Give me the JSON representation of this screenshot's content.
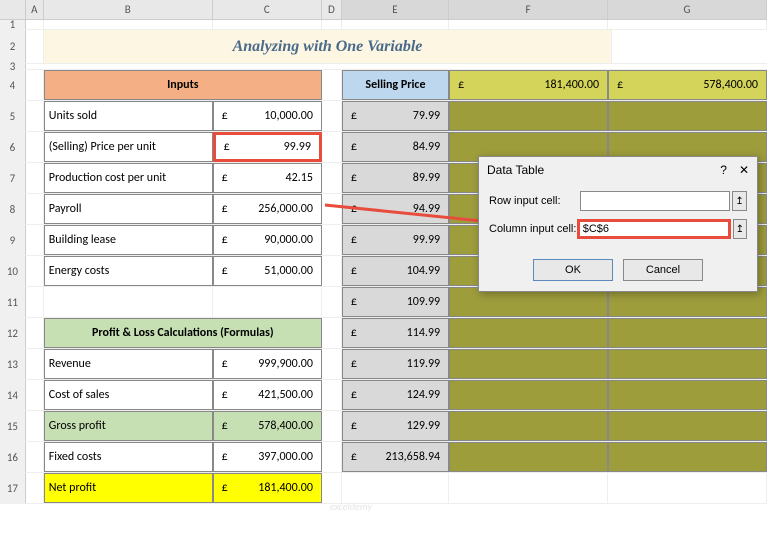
{
  "title": "Analyzing with One Variable",
  "cols": [
    "A",
    "B",
    "C",
    "D",
    "E",
    "F",
    "G"
  ],
  "rows": [
    "1",
    "2",
    "3",
    "4",
    "5",
    "6",
    "7",
    "8",
    "9",
    "10",
    "11",
    "12",
    "13",
    "14",
    "15",
    "16",
    "17"
  ],
  "inputs_header": "Inputs",
  "inputs": [
    {
      "label": "Units sold",
      "curr": "£",
      "val": "10,000.00"
    },
    {
      "label": "(Selling) Price per unit",
      "curr": "£",
      "val": "99.99"
    },
    {
      "label": "Production cost per unit",
      "curr": "£",
      "val": "42.15"
    },
    {
      "label": "Payroll",
      "curr": "£",
      "val": "256,000.00"
    },
    {
      "label": "Building lease",
      "curr": "£",
      "val": "90,000.00"
    },
    {
      "label": "Energy costs",
      "curr": "£",
      "val": "51,000.00"
    }
  ],
  "pl_header": "Profit & Loss Calculations (Formulas)",
  "pl": [
    {
      "label": "Revenue",
      "curr": "£",
      "val": "999,900.00"
    },
    {
      "label": "Cost of sales",
      "curr": "£",
      "val": "421,500.00"
    },
    {
      "label": "Gross profit",
      "curr": "£",
      "val": "578,400.00"
    },
    {
      "label": "Fixed costs",
      "curr": "£",
      "val": "397,000.00"
    },
    {
      "label": "Net profit",
      "curr": "£",
      "val": "181,400.00"
    }
  ],
  "selling_header": "Selling Price",
  "selling_f": {
    "curr": "£",
    "val": "181,400.00"
  },
  "selling_g": {
    "curr": "£",
    "val": "578,400.00"
  },
  "selling_rows": [
    {
      "curr": "£",
      "val": "79.99"
    },
    {
      "curr": "£",
      "val": "84.99"
    },
    {
      "curr": "£",
      "val": "89.99"
    },
    {
      "curr": "£",
      "val": "94.99"
    },
    {
      "curr": "£",
      "val": "99.99"
    },
    {
      "curr": "£",
      "val": "104.99"
    },
    {
      "curr": "£",
      "val": "109.99"
    },
    {
      "curr": "£",
      "val": "114.99"
    },
    {
      "curr": "£",
      "val": "119.99"
    },
    {
      "curr": "£",
      "val": "124.99"
    },
    {
      "curr": "£",
      "val": "129.99"
    },
    {
      "curr": "£",
      "val": "213,658.94"
    }
  ],
  "dialog": {
    "title": "Data Table",
    "help": "?",
    "close": "✕",
    "row_label": "Row input cell:",
    "row_val": "",
    "col_label": "Column input cell:",
    "col_val": "$C$6",
    "ok": "OK",
    "cancel": "Cancel",
    "picker": "↥"
  },
  "watermark": "exceldemy"
}
